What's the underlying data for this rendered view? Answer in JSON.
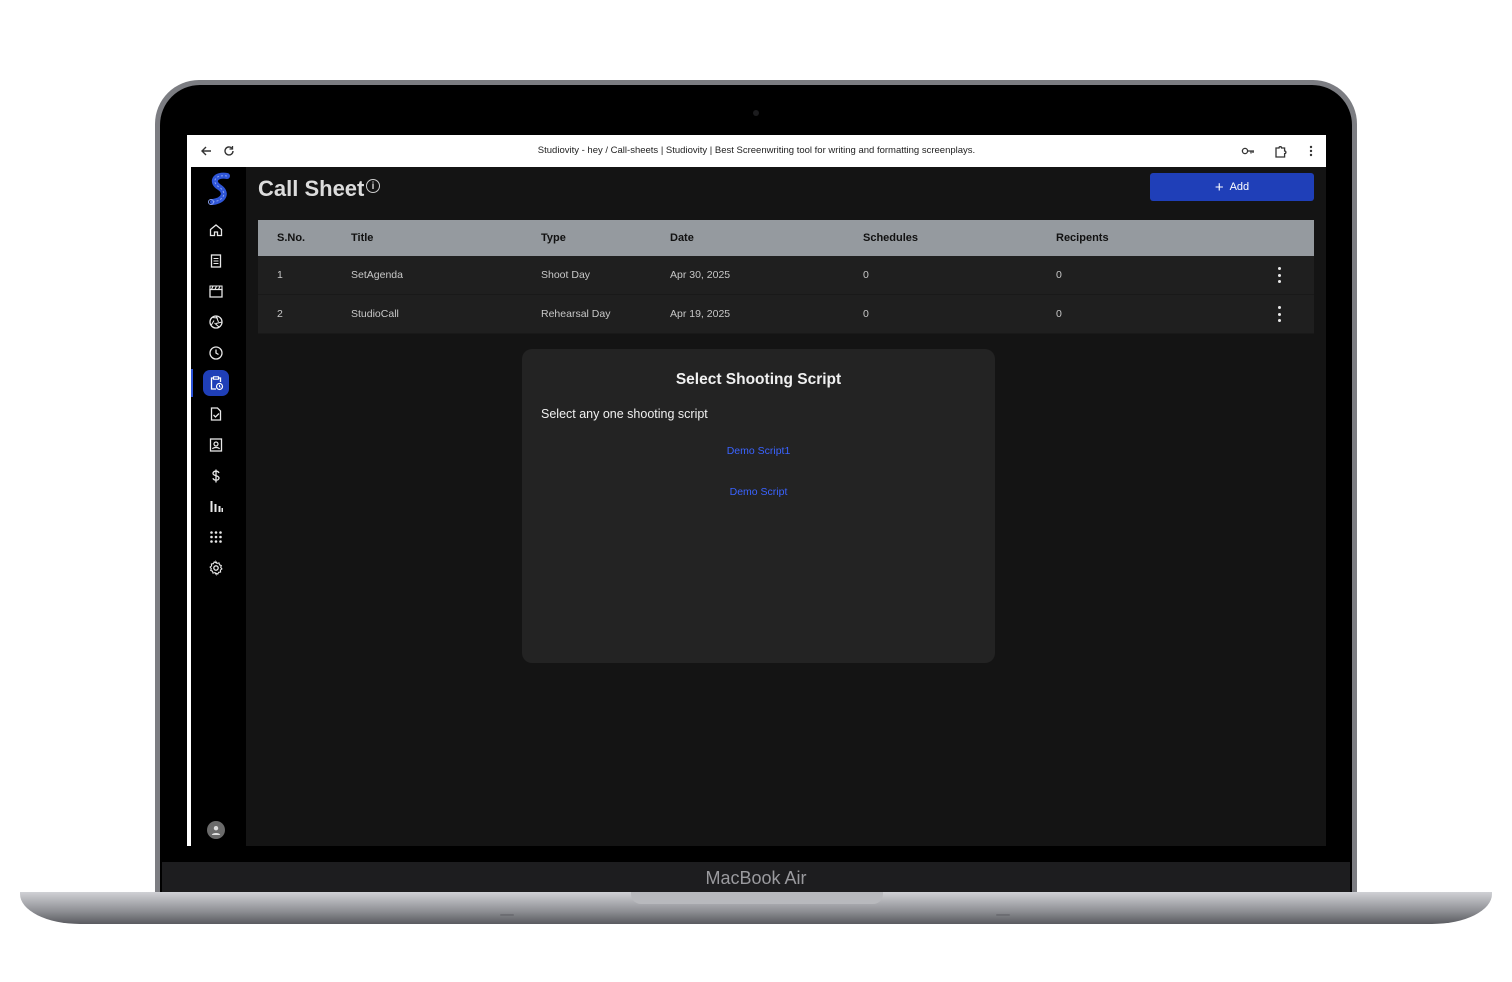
{
  "device": {
    "brand_label": "MacBook Air"
  },
  "browser": {
    "title": "Studiovity - hey / Call-sheets | Studiovity | Best Screenwriting tool for writing and formatting screenplays.",
    "back_icon": "arrow-left-icon",
    "reload_icon": "reload-icon",
    "password_icon": "key-icon",
    "extensions_icon": "puzzle-icon",
    "menu_icon": "kebab-icon"
  },
  "sidebar": {
    "items": [
      {
        "icon": "home-icon"
      },
      {
        "icon": "document-icon"
      },
      {
        "icon": "clapperboard-icon"
      },
      {
        "icon": "aperture-icon"
      },
      {
        "icon": "clock-icon"
      },
      {
        "icon": "clipboard-clock-icon",
        "active": true
      },
      {
        "icon": "file-check-icon"
      },
      {
        "icon": "contact-card-icon"
      },
      {
        "icon": "dollar-icon"
      },
      {
        "icon": "bar-chart-icon"
      },
      {
        "icon": "apps-grid-icon"
      },
      {
        "icon": "gear-icon"
      }
    ],
    "accent": "#1f3fb8"
  },
  "header": {
    "title": "Call Sheet",
    "add_label": "Add"
  },
  "table": {
    "columns": [
      "S.No.",
      "Title",
      "Type",
      "Date",
      "Schedules",
      "Recipents"
    ],
    "rows": [
      {
        "sno": "1",
        "title": "SetAgenda",
        "type": "Shoot Day",
        "date": "Apr 30, 2025",
        "schedules": "0",
        "recipients": "0"
      },
      {
        "sno": "2",
        "title": "StudioCall",
        "type": "Rehearsal Day",
        "date": "Apr 19, 2025",
        "schedules": "0",
        "recipients": "0"
      }
    ]
  },
  "dialog": {
    "title": "Select Shooting Script",
    "subtitle": "Select any one shooting script",
    "options": [
      "Demo Script1",
      "Demo Script"
    ]
  },
  "colors": {
    "background": "#141414",
    "header_row": "#959a9f",
    "link": "#3a63ff"
  }
}
